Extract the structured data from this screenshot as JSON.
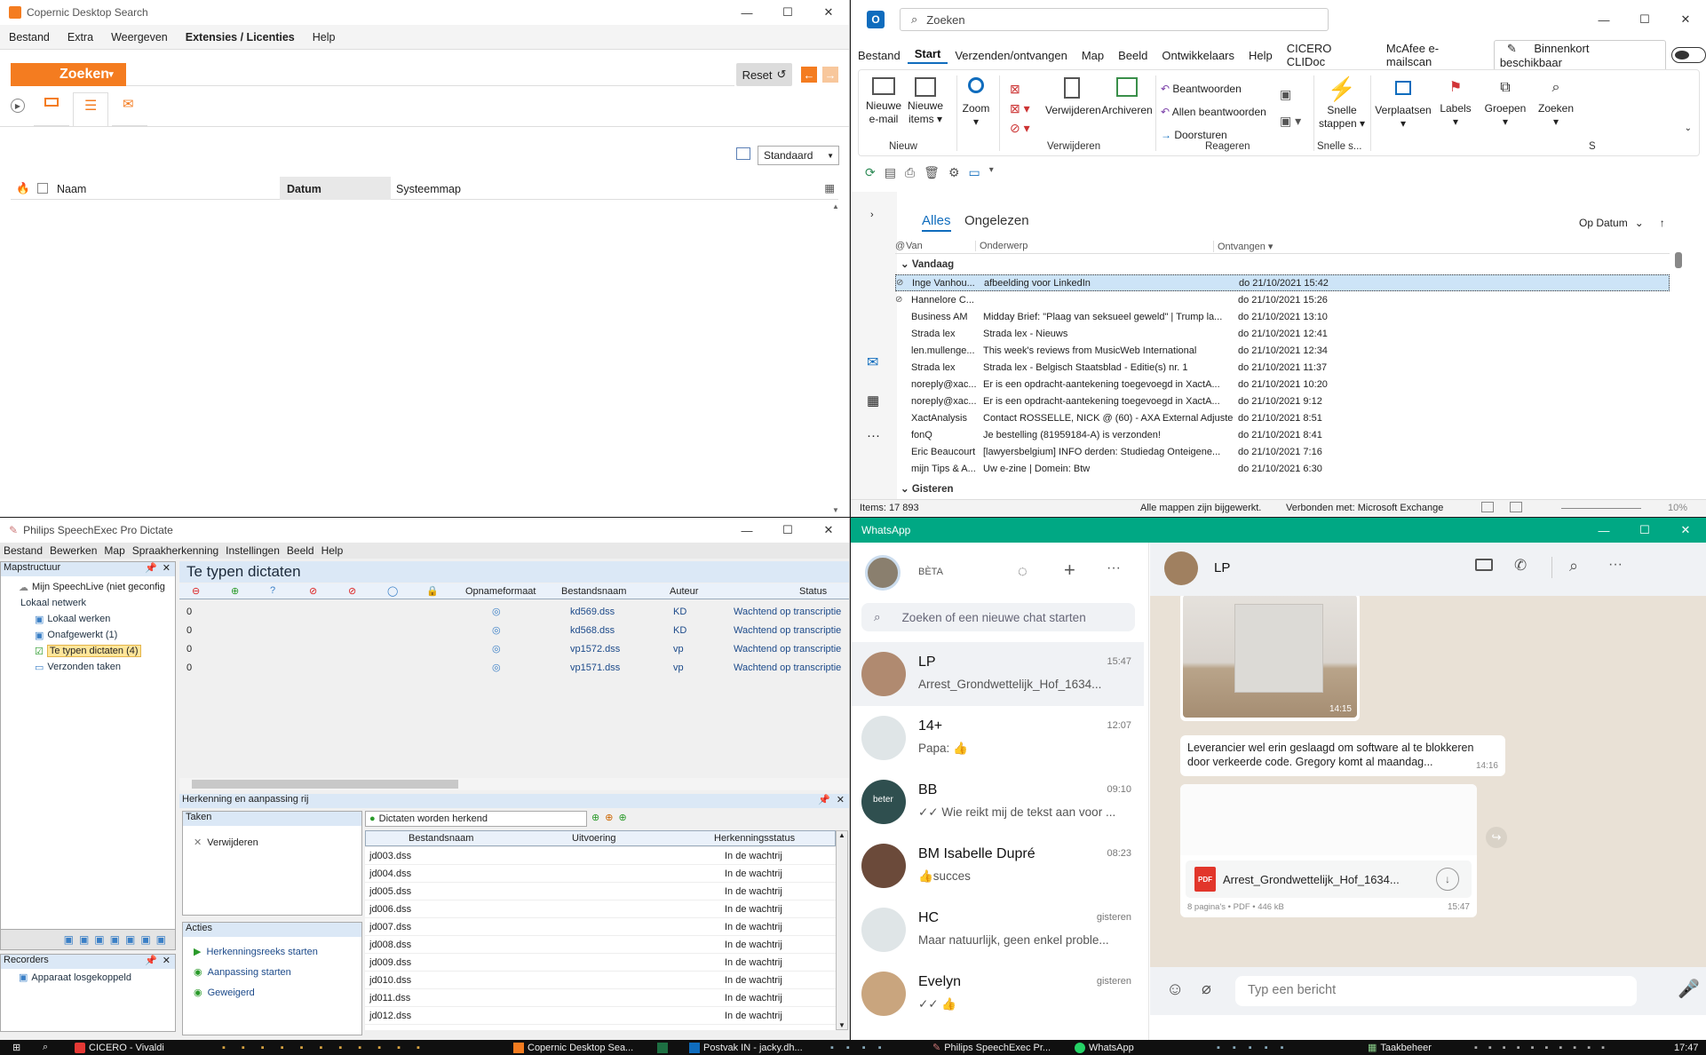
{
  "copernic": {
    "title": "Copernic Desktop Search",
    "menu": [
      "Bestand",
      "Extra",
      "Weergeven",
      "Extensies / Licenties",
      "Help"
    ],
    "search_button": "Zoeken",
    "reset_button": "Reset",
    "view_select": "Standaard",
    "columns": {
      "name": "Naam",
      "date": "Datum",
      "folder": "Systeemmap"
    }
  },
  "outlook": {
    "search_placeholder": "Zoeken",
    "menu": [
      "Bestand",
      "Start",
      "Verzenden/ontvangen",
      "Map",
      "Beeld",
      "Ontwikkelaars",
      "Help",
      "CICERO CLIDoc",
      "McAfee e-mailscan"
    ],
    "coming_soon": "Binnenkort beschikbaar",
    "ribbon": {
      "new_email_1": "Nieuwe",
      "new_email_2": "e-mail",
      "new_items_1": "Nieuwe",
      "new_items_2": "items",
      "group_new": "Nieuw",
      "zoom": "Zoom",
      "delete": "Verwijderen",
      "archive": "Archiveren",
      "group_delete": "Verwijderen",
      "reply": "Beantwoorden",
      "reply_all": "Allen beantwoorden",
      "forward": "Doorsturen",
      "group_respond": "Reageren",
      "quick_steps_1": "Snelle",
      "quick_steps_2": "stappen",
      "group_quick": "Snelle s...",
      "move": "Verplaatsen",
      "labels": "Labels",
      "groups": "Groepen",
      "search": "Zoeken",
      "group_s": "S"
    },
    "tabs": {
      "all": "Alles",
      "unread": "Ongelezen"
    },
    "sort": "Op Datum",
    "col_from": "Van",
    "col_subject": "Onderwerp",
    "col_received": "Ontvangen",
    "group_today": "Vandaag",
    "group_yesterday": "Gisteren",
    "mails": [
      {
        "from": "Inge Vanhou...",
        "subject": "afbeelding voor LinkedIn",
        "date": "do 21/10/2021 15:42"
      },
      {
        "from": "Hannelore C...",
        "subject": "",
        "date": "do 21/10/2021 15:26"
      },
      {
        "from": "Business AM",
        "subject": "Midday Brief: \"Plaag van seksueel geweld\" | Trump la...",
        "date": "do 21/10/2021 13:10"
      },
      {
        "from": "Strada lex",
        "subject": "Strada lex - Nieuws",
        "date": "do 21/10/2021 12:41"
      },
      {
        "from": "len.mullenge...",
        "subject": "This week's reviews from MusicWeb International",
        "date": "do 21/10/2021 12:34"
      },
      {
        "from": "Strada lex",
        "subject": "Strada lex - Belgisch Staatsblad - Editie(s) nr. 1",
        "date": "do 21/10/2021 11:37"
      },
      {
        "from": "noreply@xac...",
        "subject": "Er is een opdracht-aantekening toegevoegd in XactA...",
        "date": "do 21/10/2021 10:20"
      },
      {
        "from": "noreply@xac...",
        "subject": "Er is een opdracht-aantekening toegevoegd in XactA...",
        "date": "do 21/10/2021 9:12"
      },
      {
        "from": "XactAnalysis",
        "subject": "Contact ROSSELLE, NICK @ (60) - AXA External Adjuste...",
        "date": "do 21/10/2021 8:51"
      },
      {
        "from": "fonQ",
        "subject": "Je bestelling (81959184-A) is verzonden!",
        "date": "do 21/10/2021 8:41"
      },
      {
        "from": "Eric Beaucourt",
        "subject": "[lawyersbelgium] INFO derden: Studiedag Onteigene...",
        "date": "do 21/10/2021 7:16"
      },
      {
        "from": "mijn Tips & A...",
        "subject": "Uw e-zine | Domein: Btw",
        "date": "do 21/10/2021 6:30"
      }
    ],
    "status": {
      "items": "Items: 17 893",
      "updated": "Alle mappen zijn bijgewerkt.",
      "connected": "Verbonden met: Microsoft Exchange",
      "zoom": "10%"
    }
  },
  "speechexec": {
    "title": "Philips SpeechExec Pro Dictate",
    "menu": [
      "Bestand",
      "Bewerken",
      "Map",
      "Spraakherkenning",
      "Instellingen",
      "Beeld",
      "Help"
    ],
    "tree_title": "Mapstructuur",
    "tree": [
      "Mijn SpeechLive (niet geconfig",
      "Lokaal netwerk",
      "Lokaal werken",
      "Onafgewerkt (1)",
      "Te typen dictaten (4)",
      "Verzonden taken"
    ],
    "recorders_title": "Recorders",
    "recorder_status": "Apparaat losgekoppeld",
    "heading": "Te typen dictaten",
    "cols": {
      "format": "Opnameformaat",
      "file": "Bestandsnaam",
      "author": "Auteur",
      "status": "Status"
    },
    "rows": [
      {
        "prio": "0",
        "file": "kd569.dss",
        "author": "KD",
        "status": "Wachtend op transcriptie"
      },
      {
        "prio": "0",
        "file": "kd568.dss",
        "author": "KD",
        "status": "Wachtend op transcriptie"
      },
      {
        "prio": "0",
        "file": "vp1572.dss",
        "author": "vp",
        "status": "Wachtend op transcriptie"
      },
      {
        "prio": "0",
        "file": "vp1571.dss",
        "author": "vp",
        "status": "Wachtend op transcriptie"
      }
    ],
    "recog_title": "Herkenning en aanpassing rij",
    "tasks_title": "Taken",
    "task_delete": "Verwijderen",
    "actions_title": "Acties",
    "actions": [
      "Herkenningsreeks starten",
      "Aanpassing starten",
      "Geweigerd"
    ],
    "recog_filter": "Dictaten worden herkend",
    "recog_cols": {
      "file": "Bestandsnaam",
      "exec": "Uitvoering",
      "status": "Herkenningsstatus"
    },
    "recog_rows": [
      {
        "file": "jd003.dss",
        "status": "In de wachtrij"
      },
      {
        "file": "jd004.dss",
        "status": "In de wachtrij"
      },
      {
        "file": "jd005.dss",
        "status": "In de wachtrij"
      },
      {
        "file": "jd006.dss",
        "status": "In de wachtrij"
      },
      {
        "file": "jd007.dss",
        "status": "In de wachtrij"
      },
      {
        "file": "jd008.dss",
        "status": "In de wachtrij"
      },
      {
        "file": "jd009.dss",
        "status": "In de wachtrij"
      },
      {
        "file": "jd010.dss",
        "status": "In de wachtrij"
      },
      {
        "file": "jd011.dss",
        "status": "In de wachtrij"
      },
      {
        "file": "jd012.dss",
        "status": "In de wachtrij"
      }
    ]
  },
  "whatsapp": {
    "title": "WhatsApp",
    "beta": "BÈTA",
    "search_placeholder": "Zoeken of een nieuwe chat starten",
    "chats": [
      {
        "name": "LP",
        "time": "15:47",
        "preview": "Arrest_Grondwettelijk_Hof_1634..."
      },
      {
        "name": "14+",
        "time": "12:07",
        "preview": "Papa: 👍"
      },
      {
        "name": "BB",
        "time": "09:10",
        "preview": "✓✓ Wie reikt mij de tekst aan voor ..."
      },
      {
        "name": "BM Isabelle Dupré",
        "time": "08:23",
        "preview": "👍succes"
      },
      {
        "name": "HC",
        "time": "gisteren",
        "preview": "Maar natuurlijk, geen enkel proble..."
      },
      {
        "name": "Evelyn",
        "time": "gisteren",
        "preview": "✓✓ 👍"
      }
    ],
    "bb_avatar_text": "beter",
    "active_chat": "LP",
    "image_time": "14:15",
    "message_text": "Leverancier wel erin geslaagd om software al te blokkeren  door verkeerde code. Gregory komt al maandag...",
    "message_time": "14:16",
    "file_name": "Arrest_Grondwettelijk_Hof_1634...",
    "file_badge": "PDF",
    "file_meta": "8 pagina's • PDF • 446 kB",
    "file_time": "15:47",
    "input_placeholder": "Typ een bericht"
  },
  "taskbar": {
    "items": [
      "CICERO - Vivaldi",
      "Copernic Desktop Sea...",
      "Postvak IN - jacky.dh...",
      "Philips SpeechExec Pr...",
      "WhatsApp",
      "Taakbeheer"
    ],
    "time": "17:47"
  },
  "colors": {
    "copernic_orange": "#f47c20",
    "outlook_blue": "#0f6cbd",
    "whatsapp_green": "#00a884",
    "speechexec_blue": "#dbe8f6"
  }
}
